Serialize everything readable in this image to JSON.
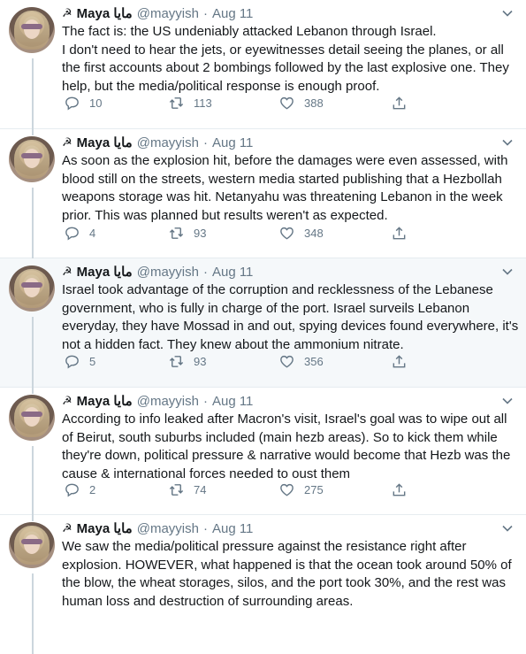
{
  "author": {
    "symbol": "☭",
    "name": "Maya مايا",
    "handle": "@mayyish",
    "separator": "·",
    "date": "Aug 11"
  },
  "tweets": [
    {
      "text": "The fact is: the US undeniably attacked Lebanon through Israel.\nI don't need to hear the jets, or eyewitnesses detail seeing the planes, or all the first accounts about 2 bombings followed by the last explosive one. They help, but the media/political response is enough proof.",
      "replies": "10",
      "retweets": "113",
      "likes": "388"
    },
    {
      "text": "As soon as the explosion hit, before the damages were even assessed, with blood still on the streets, western media started publishing that a Hezbollah weapons storage was hit. Netanyahu was threatening Lebanon in the week prior. This was planned but results weren't as expected.",
      "replies": "4",
      "retweets": "93",
      "likes": "348"
    },
    {
      "text": "Israel took advantage of the corruption and recklessness of the Lebanese government, who is fully in charge of the port. Israel surveils Lebanon everyday, they have Mossad in and out, spying devices found everywhere, it's not a hidden fact. They knew about the ammonium nitrate.",
      "replies": "5",
      "retweets": "93",
      "likes": "356"
    },
    {
      "text": "According to info leaked after Macron's visit, Israel's goal was to wipe out all of Beirut, south suburbs included (main hezb areas). So to kick them while they're down, political pressure & narrative would become that Hezb was the cause & international forces needed to oust them",
      "replies": "2",
      "retweets": "74",
      "likes": "275"
    },
    {
      "text": "We saw the media/political pressure against the resistance right after explosion. HOWEVER, what happened is that the ocean took around 50% of the blow, the wheat storages, silos, and the port took 30%, and the rest was human loss and destruction of surrounding areas.",
      "replies": "",
      "retweets": "",
      "likes": ""
    }
  ],
  "colors": {
    "text": "#14171a",
    "muted": "#657786",
    "divider": "#e6ecf0",
    "highlight_bg": "#f5f8fa"
  }
}
